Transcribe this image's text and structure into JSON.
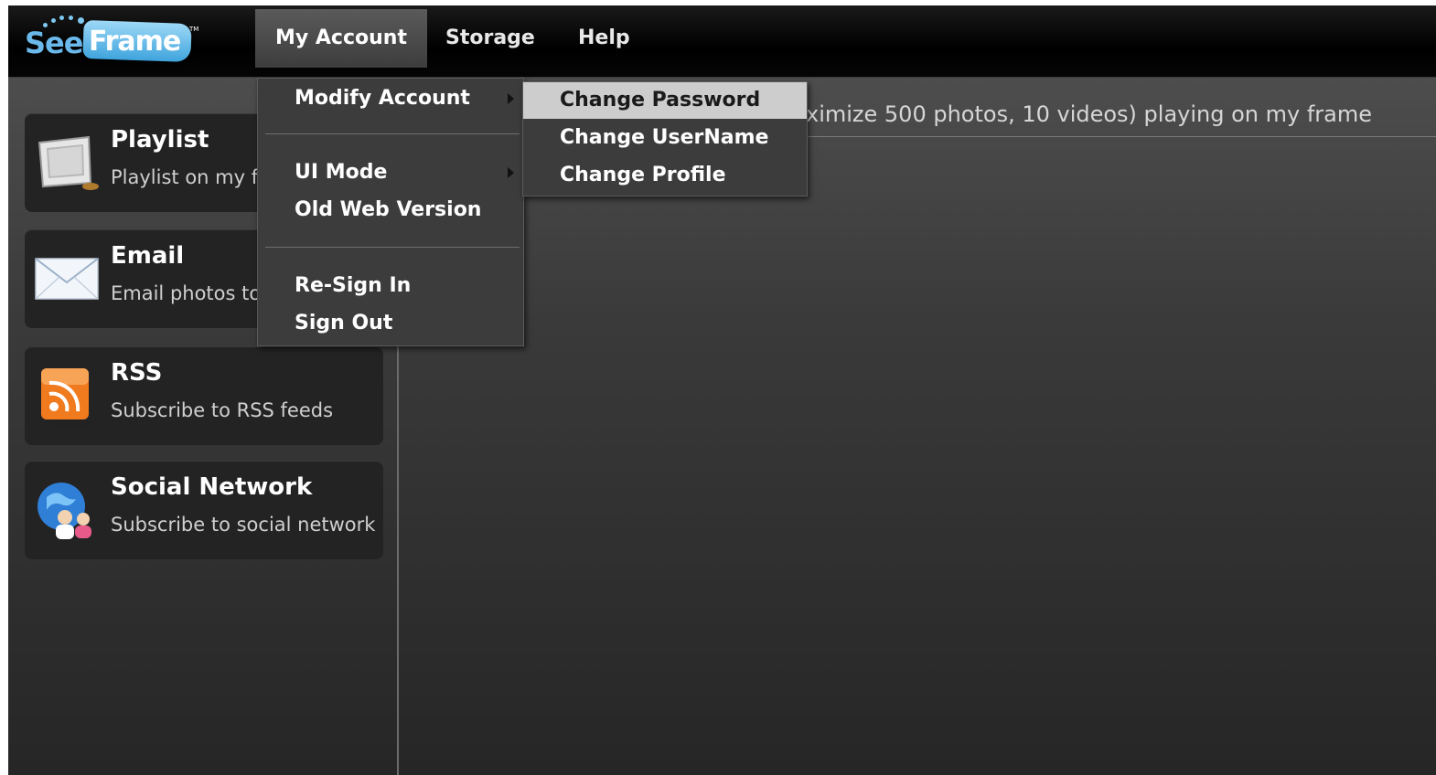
{
  "logo": {
    "see": "See",
    "frame": "Frame",
    "tm": "TM"
  },
  "nav": {
    "items": [
      {
        "label": "My Account"
      },
      {
        "label": "Storage"
      },
      {
        "label": "Help"
      }
    ]
  },
  "sidebar": {
    "cards": [
      {
        "title": "Playlist",
        "desc": "Playlist on my fr",
        "icon": "photo-frame-icon"
      },
      {
        "title": "Email",
        "desc": "Email photos to",
        "icon": "envelope-icon"
      },
      {
        "title": "RSS",
        "desc": "Subscribe to RSS feeds",
        "icon": "rss-feed-icon"
      },
      {
        "title": "Social Network",
        "desc": "Subscribe to social network",
        "icon": "social-globe-icon"
      }
    ]
  },
  "main": {
    "header_text": "ximize 500 photos, 10 videos) playing on my frame"
  },
  "account_menu": {
    "items": [
      {
        "label": "Modify Account",
        "has_submenu": true
      },
      {
        "label": "UI Mode",
        "has_submenu": true
      },
      {
        "label": "Old Web Version"
      },
      {
        "label": "Re-Sign In"
      },
      {
        "label": "Sign Out"
      }
    ]
  },
  "modify_submenu": {
    "items": [
      {
        "label": "Change Password",
        "highlighted": true
      },
      {
        "label": "Change UserName"
      },
      {
        "label": "Change Profile"
      }
    ]
  },
  "colors": {
    "accent": "#6ab9ea",
    "background": "#2f2f2f",
    "menu_highlight": "#cdcdcd"
  }
}
